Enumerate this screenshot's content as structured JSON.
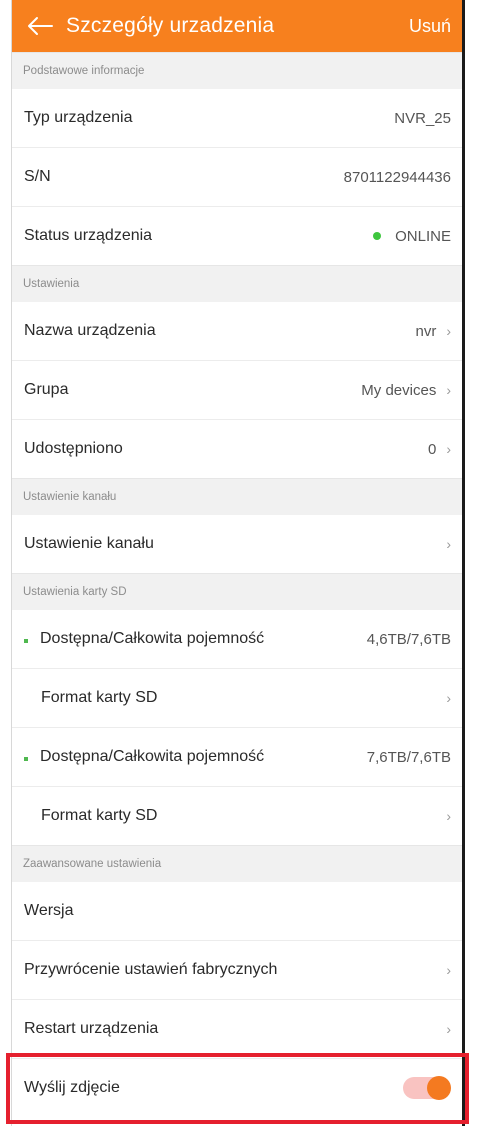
{
  "header": {
    "title": "Szczegóły urzadzenia",
    "delete_label": "Usuń"
  },
  "sections": {
    "basic": "Podstawowe informacje",
    "settings": "Ustawienia",
    "channel": "Ustawienie kanału",
    "sd": "Ustawienia karty SD",
    "advanced": "Zaawansowane ustawienia"
  },
  "basic": {
    "type_label": "Typ urządzenia",
    "type_value": "NVR_25",
    "sn_label": "S/N",
    "sn_value": "8701122944436",
    "status_label": "Status urządzenia",
    "status_value": "ONLINE"
  },
  "settings": {
    "name_label": "Nazwa urządzenia",
    "name_value": "nvr",
    "group_label": "Grupa",
    "group_value": "My devices",
    "shared_label": "Udostępniono",
    "shared_value": "0"
  },
  "channel": {
    "setting_label": "Ustawienie kanału"
  },
  "sd": {
    "card1_label": "Dostępna/Całkowita pojemność",
    "card1_value": "4,6TB/7,6TB",
    "format1_label": "Format karty SD",
    "card2_label": "Dostępna/Całkowita pojemność",
    "card2_value": "7,6TB/7,6TB",
    "format2_label": "Format karty SD"
  },
  "advanced": {
    "version_label": "Wersja",
    "factory_label": "Przywrócenie ustawień fabrycznych",
    "restart_label": "Restart urządzenia",
    "send_photo_label": "Wyślij zdjęcie",
    "send_photo_enabled": true
  },
  "colors": {
    "accent": "#f7801e",
    "online": "#3ec63e",
    "highlight": "#e5202e"
  },
  "icons": {
    "back": "arrow-left-icon",
    "chevron": "chevron-right-icon"
  }
}
